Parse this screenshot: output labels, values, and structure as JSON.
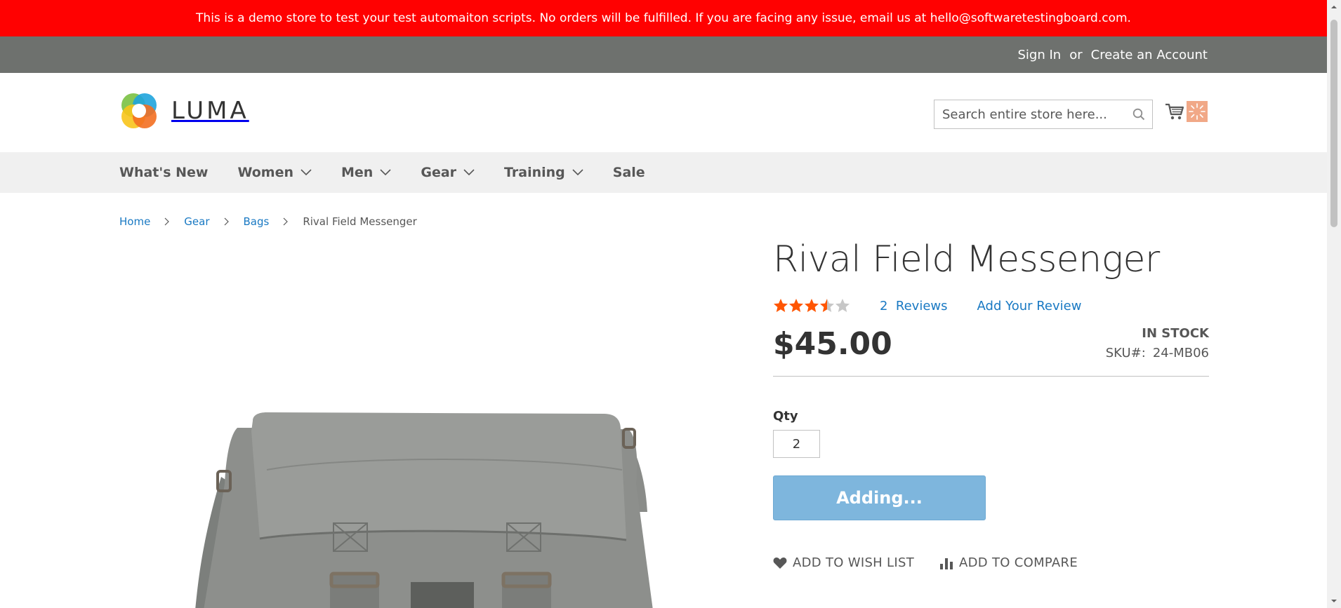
{
  "banner": {
    "text": "This is a demo store to test your test automaiton scripts. No orders will be fulfilled. If you are facing any issue, email us at hello@softwaretestingboard.com."
  },
  "account_links": {
    "sign_in": "Sign In",
    "or": "or",
    "create_account": "Create an Account"
  },
  "header": {
    "logo_text": "LUMA",
    "search_placeholder": "Search entire store here...",
    "cart_count_icon": "loading-spinner-icon"
  },
  "nav": {
    "items": [
      {
        "label": "What's New",
        "has_dropdown": false
      },
      {
        "label": "Women",
        "has_dropdown": true
      },
      {
        "label": "Men",
        "has_dropdown": true
      },
      {
        "label": "Gear",
        "has_dropdown": true
      },
      {
        "label": "Training",
        "has_dropdown": true
      },
      {
        "label": "Sale",
        "has_dropdown": false
      }
    ]
  },
  "breadcrumbs": {
    "items": [
      "Home",
      "Gear",
      "Bags"
    ],
    "current": "Rival Field Messenger"
  },
  "product": {
    "title": "Rival Field Messenger",
    "rating_stars": 3.5,
    "review_count": "2",
    "reviews_label": "Reviews",
    "add_review": "Add Your Review",
    "price": "$45.00",
    "stock": "IN STOCK",
    "sku_label": "SKU#:",
    "sku": "24-MB06",
    "qty_label": "Qty",
    "qty_value": "2",
    "add_button": "Adding...",
    "wishlist": "ADD TO WISH LIST",
    "compare": "ADD TO COMPARE"
  },
  "colors": {
    "banner": "#ff0101",
    "panel": "#6e716e",
    "link": "#1979c3",
    "star": "#ff5501",
    "button_disabled": "#7eb6dd"
  }
}
